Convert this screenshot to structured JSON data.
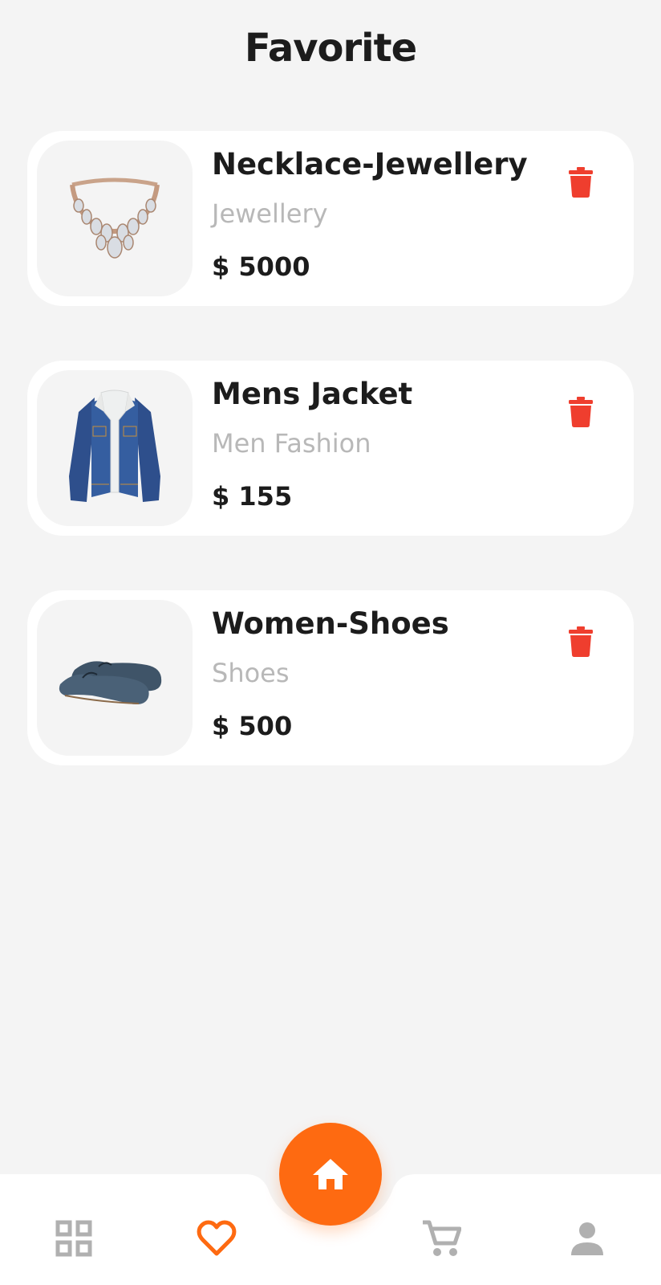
{
  "header": {
    "title": "Favorite"
  },
  "favorites": [
    {
      "name": "Necklace-Jewellery",
      "category": "Jewellery",
      "price": "$ 5000",
      "image": "necklace-image"
    },
    {
      "name": "Mens Jacket",
      "category": "Men Fashion",
      "price": "$ 155",
      "image": "denim-jacket-image"
    },
    {
      "name": "Women-Shoes",
      "category": "Shoes",
      "price": "$ 500",
      "image": "shoes-image"
    }
  ],
  "icons": {
    "delete": "trash-icon",
    "home": "home-icon",
    "categories": "grid-icon",
    "favorites": "heart-icon",
    "cart": "cart-icon",
    "profile": "person-icon"
  },
  "bottom_nav": {
    "active": "favorites",
    "items": [
      "categories",
      "favorites",
      "home",
      "cart",
      "profile"
    ]
  },
  "colors": {
    "accent": "#fe6a11",
    "delete": "#ef3e2e",
    "inactive_icon": "#b0b0b0",
    "background": "#f4f4f4",
    "card": "#ffffff",
    "muted_text": "#b8b8b8"
  }
}
